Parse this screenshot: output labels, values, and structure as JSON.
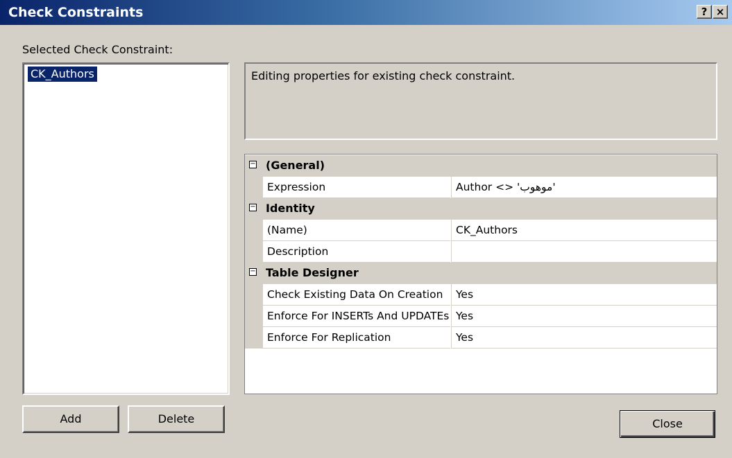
{
  "window": {
    "title": "Check Constraints",
    "help_label": "?",
    "close_label": "×"
  },
  "left": {
    "label": "Selected Check Constraint:",
    "items": [
      "CK_Authors"
    ],
    "add_label": "Add",
    "delete_label": "Delete"
  },
  "description": "Editing properties for existing check constraint.",
  "grid": {
    "rows": [
      {
        "kind": "category",
        "toggle": "−",
        "label": "(General)"
      },
      {
        "kind": "property",
        "name": "Expression",
        "value": "Author <> 'موهوب'"
      },
      {
        "kind": "category",
        "toggle": "−",
        "label": "Identity"
      },
      {
        "kind": "property",
        "name": "(Name)",
        "value": "CK_Authors"
      },
      {
        "kind": "property",
        "name": "Description",
        "value": ""
      },
      {
        "kind": "category",
        "toggle": "−",
        "label": "Table Designer"
      },
      {
        "kind": "property",
        "name": "Check Existing Data On Creation",
        "value": "Yes"
      },
      {
        "kind": "property",
        "name": "Enforce For INSERTs And UPDATEs",
        "value": "Yes"
      },
      {
        "kind": "property",
        "name": "Enforce For Replication",
        "value": "Yes"
      }
    ]
  },
  "footer": {
    "close_label": "Close"
  }
}
